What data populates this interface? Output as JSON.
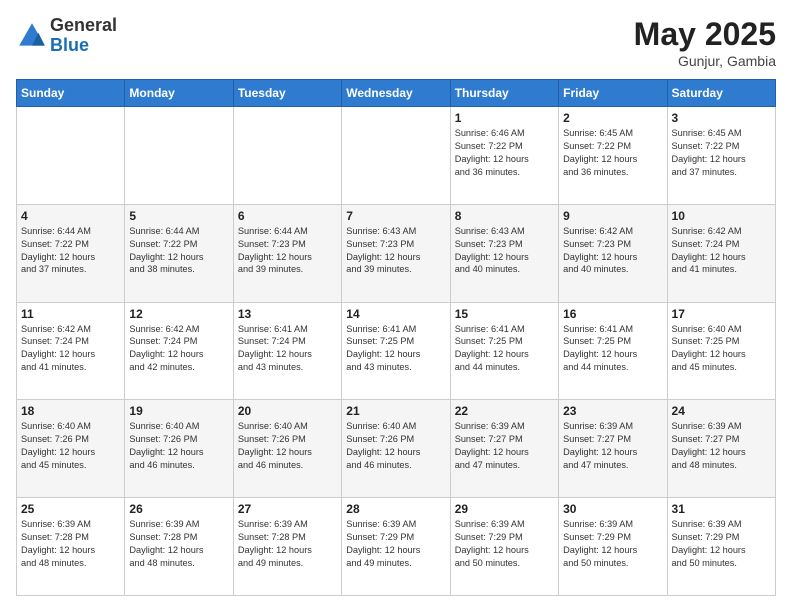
{
  "header": {
    "logo_general": "General",
    "logo_blue": "Blue",
    "month_title": "May 2025",
    "location": "Gunjur, Gambia"
  },
  "days_of_week": [
    "Sunday",
    "Monday",
    "Tuesday",
    "Wednesday",
    "Thursday",
    "Friday",
    "Saturday"
  ],
  "weeks": [
    [
      {
        "day": "",
        "info": ""
      },
      {
        "day": "",
        "info": ""
      },
      {
        "day": "",
        "info": ""
      },
      {
        "day": "",
        "info": ""
      },
      {
        "day": "1",
        "info": "Sunrise: 6:46 AM\nSunset: 7:22 PM\nDaylight: 12 hours\nand 36 minutes."
      },
      {
        "day": "2",
        "info": "Sunrise: 6:45 AM\nSunset: 7:22 PM\nDaylight: 12 hours\nand 36 minutes."
      },
      {
        "day": "3",
        "info": "Sunrise: 6:45 AM\nSunset: 7:22 PM\nDaylight: 12 hours\nand 37 minutes."
      }
    ],
    [
      {
        "day": "4",
        "info": "Sunrise: 6:44 AM\nSunset: 7:22 PM\nDaylight: 12 hours\nand 37 minutes."
      },
      {
        "day": "5",
        "info": "Sunrise: 6:44 AM\nSunset: 7:22 PM\nDaylight: 12 hours\nand 38 minutes."
      },
      {
        "day": "6",
        "info": "Sunrise: 6:44 AM\nSunset: 7:23 PM\nDaylight: 12 hours\nand 39 minutes."
      },
      {
        "day": "7",
        "info": "Sunrise: 6:43 AM\nSunset: 7:23 PM\nDaylight: 12 hours\nand 39 minutes."
      },
      {
        "day": "8",
        "info": "Sunrise: 6:43 AM\nSunset: 7:23 PM\nDaylight: 12 hours\nand 40 minutes."
      },
      {
        "day": "9",
        "info": "Sunrise: 6:42 AM\nSunset: 7:23 PM\nDaylight: 12 hours\nand 40 minutes."
      },
      {
        "day": "10",
        "info": "Sunrise: 6:42 AM\nSunset: 7:24 PM\nDaylight: 12 hours\nand 41 minutes."
      }
    ],
    [
      {
        "day": "11",
        "info": "Sunrise: 6:42 AM\nSunset: 7:24 PM\nDaylight: 12 hours\nand 41 minutes."
      },
      {
        "day": "12",
        "info": "Sunrise: 6:42 AM\nSunset: 7:24 PM\nDaylight: 12 hours\nand 42 minutes."
      },
      {
        "day": "13",
        "info": "Sunrise: 6:41 AM\nSunset: 7:24 PM\nDaylight: 12 hours\nand 43 minutes."
      },
      {
        "day": "14",
        "info": "Sunrise: 6:41 AM\nSunset: 7:25 PM\nDaylight: 12 hours\nand 43 minutes."
      },
      {
        "day": "15",
        "info": "Sunrise: 6:41 AM\nSunset: 7:25 PM\nDaylight: 12 hours\nand 44 minutes."
      },
      {
        "day": "16",
        "info": "Sunrise: 6:41 AM\nSunset: 7:25 PM\nDaylight: 12 hours\nand 44 minutes."
      },
      {
        "day": "17",
        "info": "Sunrise: 6:40 AM\nSunset: 7:25 PM\nDaylight: 12 hours\nand 45 minutes."
      }
    ],
    [
      {
        "day": "18",
        "info": "Sunrise: 6:40 AM\nSunset: 7:26 PM\nDaylight: 12 hours\nand 45 minutes."
      },
      {
        "day": "19",
        "info": "Sunrise: 6:40 AM\nSunset: 7:26 PM\nDaylight: 12 hours\nand 46 minutes."
      },
      {
        "day": "20",
        "info": "Sunrise: 6:40 AM\nSunset: 7:26 PM\nDaylight: 12 hours\nand 46 minutes."
      },
      {
        "day": "21",
        "info": "Sunrise: 6:40 AM\nSunset: 7:26 PM\nDaylight: 12 hours\nand 46 minutes."
      },
      {
        "day": "22",
        "info": "Sunrise: 6:39 AM\nSunset: 7:27 PM\nDaylight: 12 hours\nand 47 minutes."
      },
      {
        "day": "23",
        "info": "Sunrise: 6:39 AM\nSunset: 7:27 PM\nDaylight: 12 hours\nand 47 minutes."
      },
      {
        "day": "24",
        "info": "Sunrise: 6:39 AM\nSunset: 7:27 PM\nDaylight: 12 hours\nand 48 minutes."
      }
    ],
    [
      {
        "day": "25",
        "info": "Sunrise: 6:39 AM\nSunset: 7:28 PM\nDaylight: 12 hours\nand 48 minutes."
      },
      {
        "day": "26",
        "info": "Sunrise: 6:39 AM\nSunset: 7:28 PM\nDaylight: 12 hours\nand 48 minutes."
      },
      {
        "day": "27",
        "info": "Sunrise: 6:39 AM\nSunset: 7:28 PM\nDaylight: 12 hours\nand 49 minutes."
      },
      {
        "day": "28",
        "info": "Sunrise: 6:39 AM\nSunset: 7:29 PM\nDaylight: 12 hours\nand 49 minutes."
      },
      {
        "day": "29",
        "info": "Sunrise: 6:39 AM\nSunset: 7:29 PM\nDaylight: 12 hours\nand 50 minutes."
      },
      {
        "day": "30",
        "info": "Sunrise: 6:39 AM\nSunset: 7:29 PM\nDaylight: 12 hours\nand 50 minutes."
      },
      {
        "day": "31",
        "info": "Sunrise: 6:39 AM\nSunset: 7:29 PM\nDaylight: 12 hours\nand 50 minutes."
      }
    ]
  ]
}
